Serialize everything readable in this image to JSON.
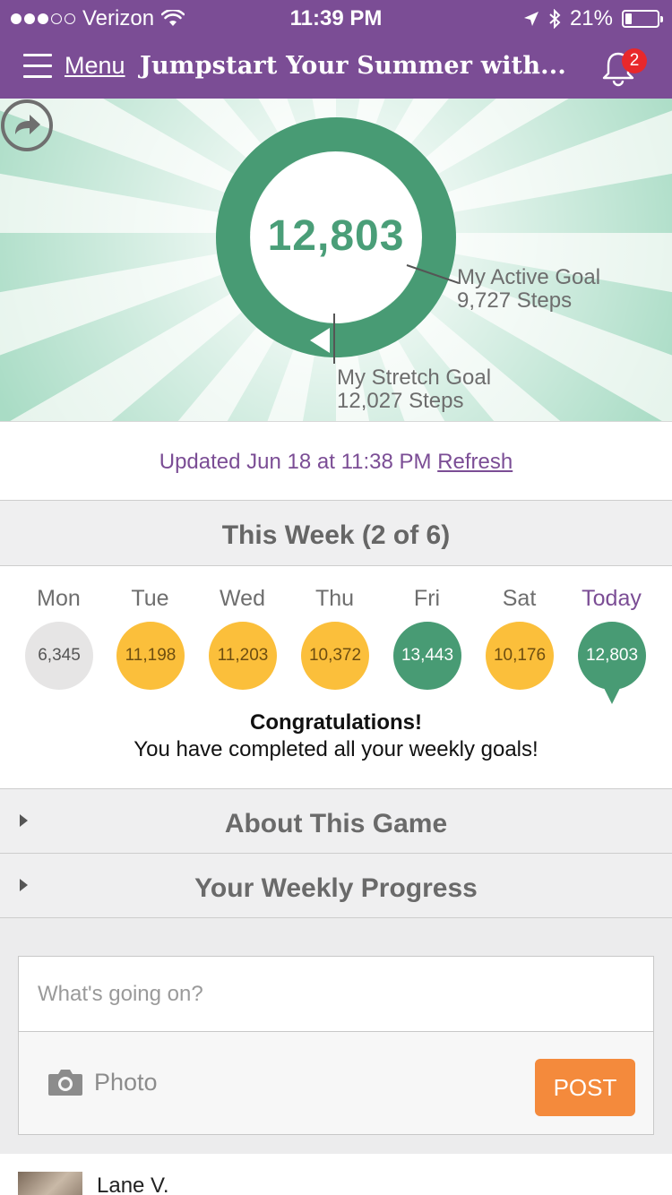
{
  "status_bar": {
    "carrier": "Verizon",
    "time": "11:39 PM",
    "battery": "21%",
    "battery_level": 0.21
  },
  "nav": {
    "menu_label": "Menu",
    "title": "Jumpstart Your Summer with...",
    "notification_count": "2"
  },
  "hero": {
    "steps": "12,803",
    "active_goal_label": "My Active Goal",
    "active_goal_value": "9,727 Steps",
    "stretch_goal_label": "My Stretch Goal",
    "stretch_goal_value": "12,027 Steps",
    "progress_color": "#4a9e78"
  },
  "updated": {
    "text": "Updated Jun 18 at 11:38 PM",
    "refresh_label": "Refresh"
  },
  "week": {
    "title": "This Week (2 of 6)",
    "days": [
      {
        "label": "Mon",
        "steps": "6,345",
        "status": "gray"
      },
      {
        "label": "Tue",
        "steps": "11,198",
        "status": "yellow"
      },
      {
        "label": "Wed",
        "steps": "11,203",
        "status": "yellow"
      },
      {
        "label": "Thu",
        "steps": "10,372",
        "status": "yellow"
      },
      {
        "label": "Fri",
        "steps": "13,443",
        "status": "green"
      },
      {
        "label": "Sat",
        "steps": "10,176",
        "status": "yellow"
      },
      {
        "label": "Today",
        "steps": "12,803",
        "status": "green"
      }
    ],
    "congrats_title": "Congratulations!",
    "congrats_message": "You have completed all your weekly goals!"
  },
  "sections": {
    "about": "About This Game",
    "progress": "Your Weekly Progress"
  },
  "composer": {
    "placeholder": "What's going on?",
    "photo_label": "Photo",
    "post_label": "POST"
  },
  "feed": {
    "first_name": "Lane V."
  },
  "colors": {
    "brand_purple": "#7b4d95",
    "goal_green": "#489b74",
    "goal_yellow": "#fbbf3b",
    "post_orange": "#f48a3c",
    "badge_red": "#e8282b"
  }
}
